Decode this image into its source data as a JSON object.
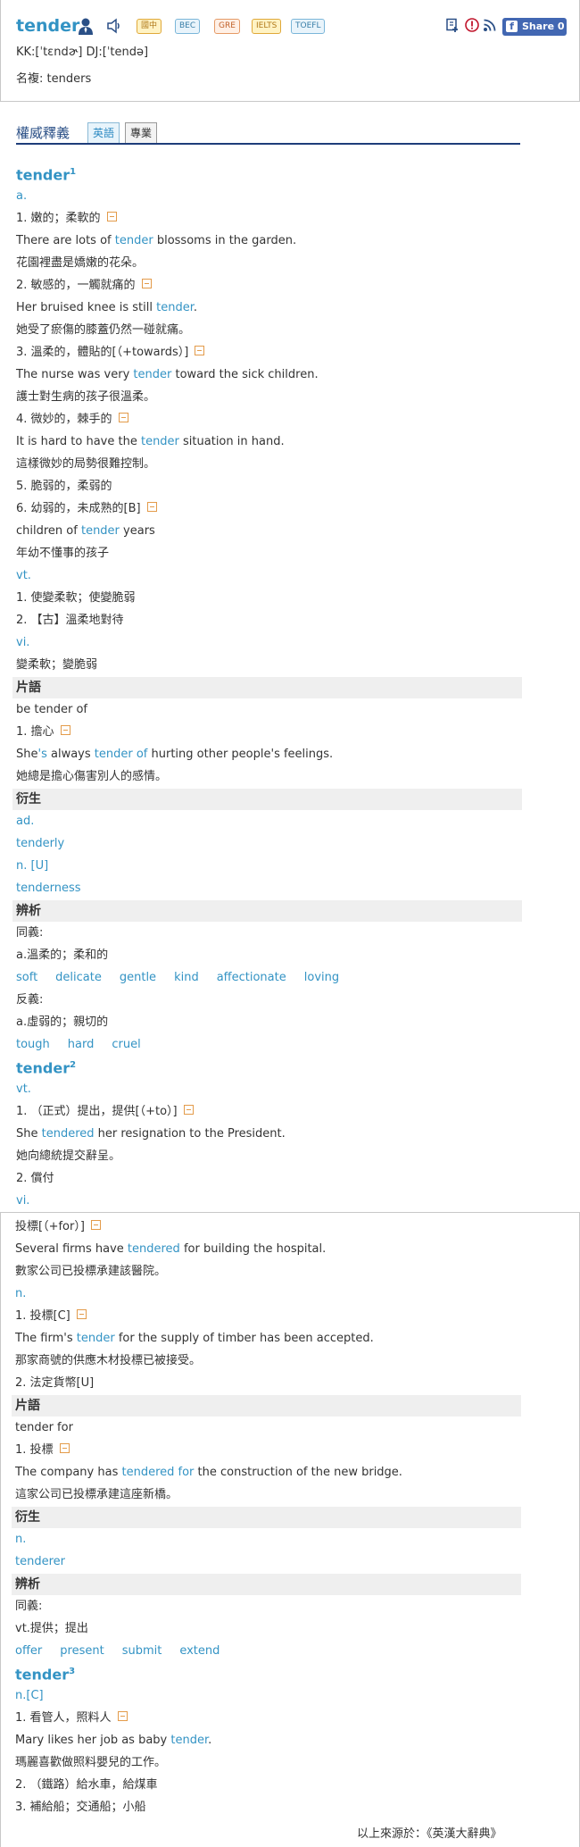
{
  "header": {
    "word": "tender",
    "badges": [
      "國中",
      "BEC",
      "GRE",
      "IELTS",
      "TOEFL"
    ],
    "share_label": "Share 0",
    "pronunciation": "KK:[ˈtɛndɚ] DJ:[ˈtendə]",
    "inflection": "名複: tenders"
  },
  "authority": {
    "title": "權威釋義",
    "tabs": [
      "英語",
      "專業"
    ]
  },
  "entry": {
    "hw1": "tender",
    "hw1_sup": "1",
    "a": "a.",
    "s1": "1. 嫩的；柔軟的",
    "e1a": "There are lots of ",
    "e1k": "tender",
    "e1b": " blossoms in the garden.",
    "z1": "花園裡盡是嬌嫩的花朵。",
    "s2": "2. 敏感的，一觸就痛的",
    "e2a": "Her bruised knee is still ",
    "e2k": "tender",
    "e2b": ".",
    "z2": "她受了瘀傷的膝蓋仍然一碰就痛。",
    "s3": "3. 溫柔的，體貼的[（+towards）]",
    "e3a": "The nurse was very ",
    "e3k": "tender",
    "e3b": " toward the sick children.",
    "z3": "護士對生病的孩子很溫柔。",
    "s4": "4. 微妙的，棘手的",
    "e4a": "It is hard to have the ",
    "e4k": "tender",
    "e4b": " situation in hand.",
    "z4": "這樣微妙的局勢很難控制。",
    "s5": "5. 脆弱的，柔弱的",
    "s6": "6. 幼弱的，未成熟的[B]",
    "e6a": "children of ",
    "e6k": "tender",
    "e6b": " years",
    "z6": "年幼不懂事的孩子",
    "vt": "vt.",
    "vt1": "1. 使變柔軟；使變脆弱",
    "vt2": "2. 【古】溫柔地對待",
    "vi": "vi.",
    "vi1": "變柔軟；變脆弱",
    "phrase_head": "片語",
    "p1": "be tender of",
    "p1s": "1. 擔心",
    "p1e_a": "She",
    "p1e_k1": "'s",
    "p1e_b": " always ",
    "p1e_k2": "tender of",
    "p1e_c": " hurting other people's feelings.",
    "p1z": "她總是擔心傷害別人的感情。",
    "deriv_head": "衍生",
    "d_ad": "ad.",
    "d_tenderly": "tenderly",
    "d_n": "n. [U]",
    "d_tenderness": "tenderness",
    "anal_head": "辨析",
    "syn_label": "同義:",
    "syn_sense": "a.溫柔的；柔和的",
    "syn_words": [
      "soft",
      "delicate",
      "gentle",
      "kind",
      "affectionate",
      "loving"
    ],
    "ant_label": "反義:",
    "ant_sense": "a.虛弱的；親切的",
    "ant_words": [
      "tough",
      "hard",
      "cruel"
    ],
    "hw2": "tender",
    "hw2_sup": "2",
    "vt_b": "vt.",
    "t2s1": "1. （正式）提出，提供[（+to）]",
    "t2e1a": "She ",
    "t2e1k": "tendered",
    "t2e1b": " her resignation to the President.",
    "t2z1": "她向總統提交辭呈。",
    "t2s2": " 2. 償付",
    "vi_b": "vi.",
    "t2vi1": "投標[（+for）]",
    "t2e2a": "Several firms have ",
    "t2e2k": "tendered",
    "t2e2b": " for building the hospital.",
    "t2z2": "數家公司已投標承建該醫院。",
    "n_b": "n.",
    "t2n1": "1. 投標[C]",
    "t2e3a": "The firm's ",
    "t2e3k": "tender",
    "t2e3b": " for the supply of timber has been accepted.",
    "t2z3": "那家商號的供應木材投標已被接受。",
    "t2n2": "2. 法定貨幣[U]",
    "phrase_head2": "片語",
    "p2": "tender for",
    "p2s": "1. 投標",
    "p2e_a": "The company has ",
    "p2e_k": "tendered for",
    "p2e_b": " the construction of the new bridge.",
    "p2z": "這家公司已投標承建這座新橋。",
    "deriv_head2": "衍生",
    "d2_n": "n.",
    "d2_tenderer": "tenderer",
    "anal_head2": "辨析",
    "syn_label2": "同義:",
    "syn_sense2": "vt.提供；提出",
    "syn_words2": [
      "offer",
      "present",
      "submit",
      "extend"
    ],
    "hw3": "tender",
    "hw3_sup": "3",
    "n_c": "n.[C]",
    "t3s1": "1. 看管人，照料人",
    "t3e1a": "Mary likes her job as baby ",
    "t3e1k": "tender",
    "t3e1b": ".",
    "t3z1": "瑪麗喜歡做照料嬰兒的工作。",
    "t3s2": "2. （鐵路）給水車，給煤車",
    "t3s3": "3. 補給船；交通船；小船",
    "source": "以上來源於：《英漢大辭典》"
  }
}
